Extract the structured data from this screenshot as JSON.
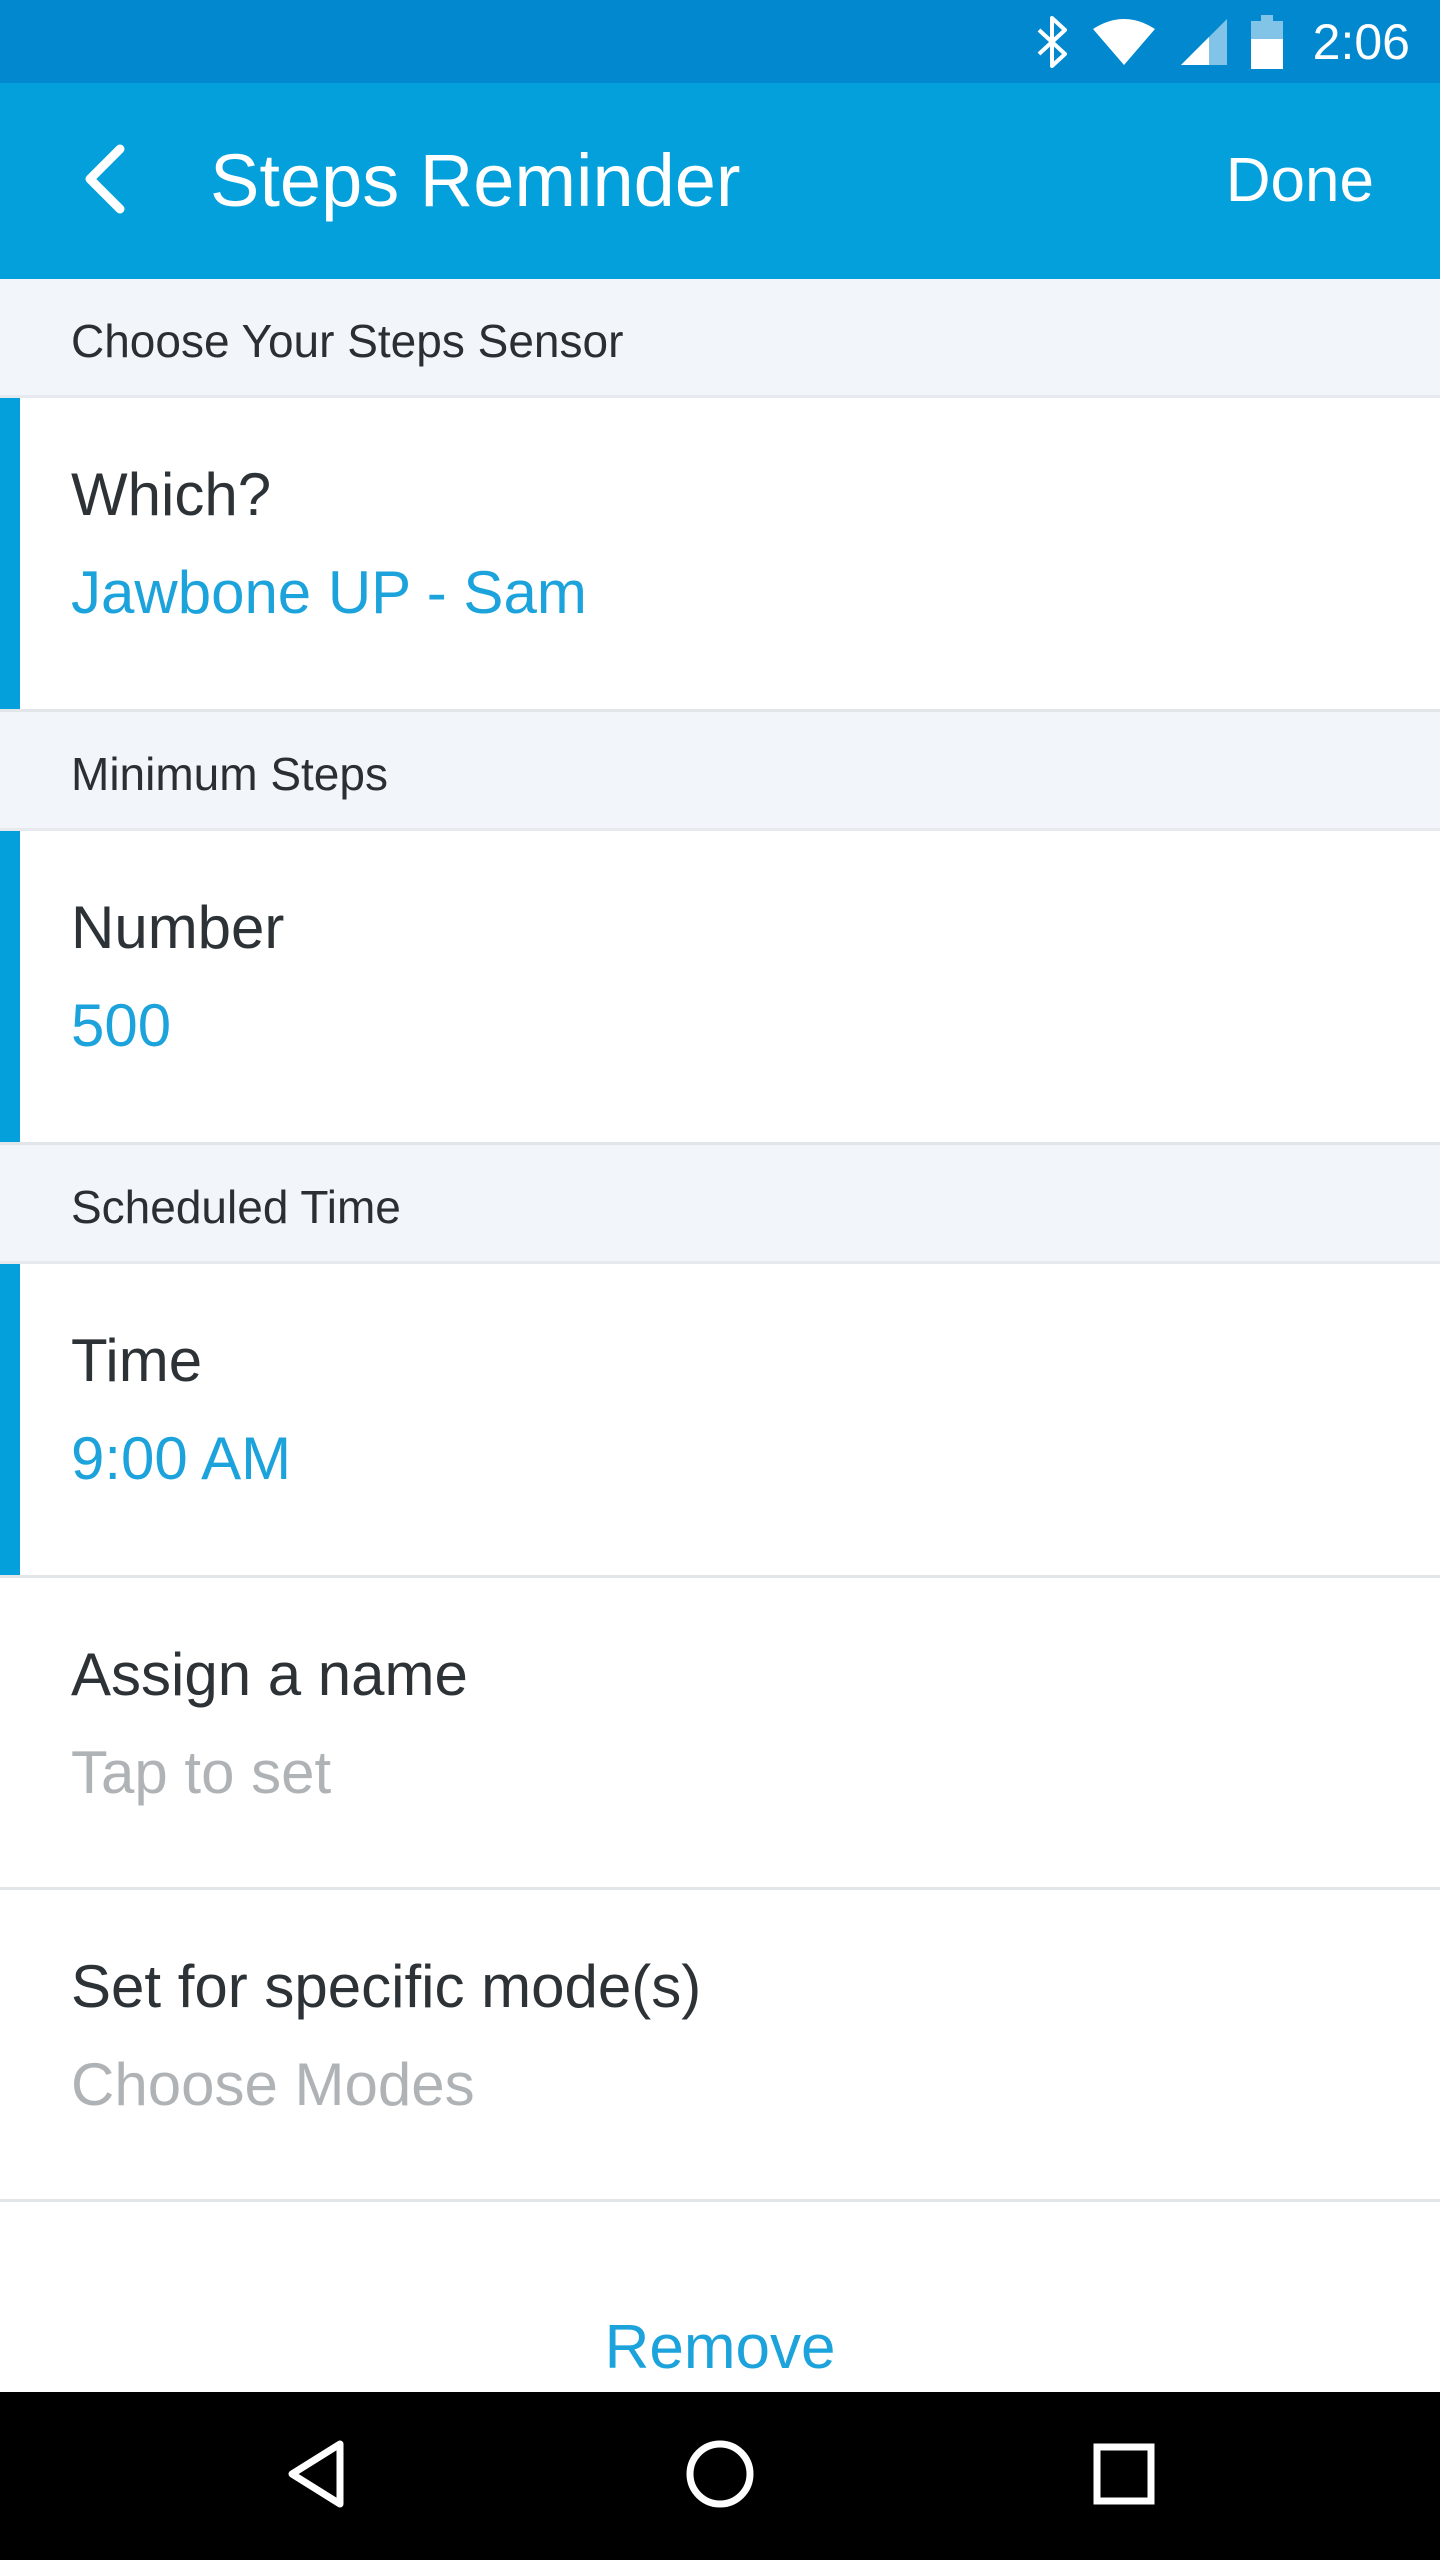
{
  "status_bar": {
    "time": "2:06",
    "icons": [
      "bluetooth-icon",
      "wifi-icon",
      "cell-signal-icon",
      "battery-icon"
    ],
    "background": "#0288cf"
  },
  "app_bar": {
    "title": "Steps Reminder",
    "done_label": "Done",
    "back_icon": "chevron-left-icon",
    "background": "#03a0db"
  },
  "sections": [
    {
      "header": "Choose Your Steps Sensor",
      "label": "Which?",
      "value": "Jawbone UP - Sam"
    },
    {
      "header": "Minimum Steps",
      "label": "Number",
      "value": "500"
    },
    {
      "header": "Scheduled Time",
      "label": "Time",
      "value": "9:00 AM"
    }
  ],
  "options": [
    {
      "label": "Assign a name",
      "placeholder": "Tap to set"
    },
    {
      "label": "Set for specific mode(s)",
      "placeholder": "Choose Modes"
    }
  ],
  "remove_label": "Remove",
  "nav_bar": {
    "icons": [
      "back-triangle-icon",
      "home-circle-icon",
      "recents-square-icon"
    ]
  },
  "colors": {
    "accent": "#03a0db",
    "value_text": "#1da3dc",
    "placeholder_text": "#b0b3b6",
    "section_header_bg": "#f2f6fb"
  }
}
